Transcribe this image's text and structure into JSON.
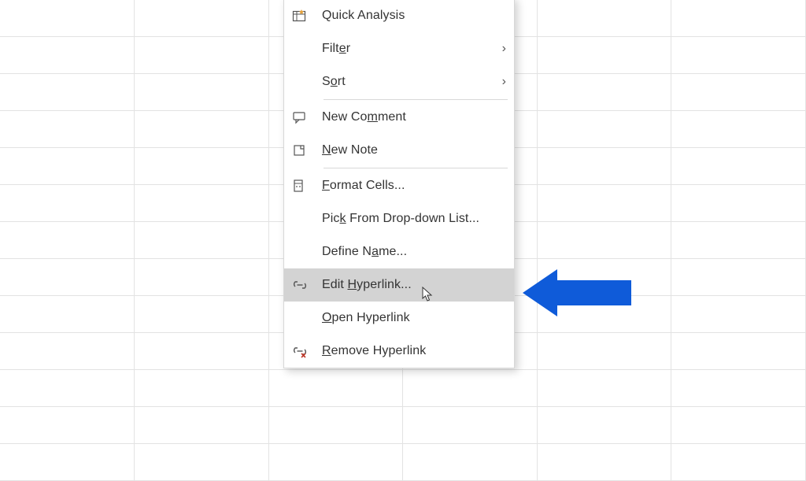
{
  "grid": {
    "rows": 12,
    "cols": 6
  },
  "menu": {
    "quick_analysis": "Quick Analysis",
    "filter": "Filter",
    "filter_pre": "Filt",
    "filter_u": "e",
    "filter_post": "r",
    "sort": "Sort",
    "sort_pre": "S",
    "sort_u": "o",
    "sort_post": "rt",
    "new_comment": "New Comment",
    "new_comment_pre": "New Co",
    "new_comment_u": "m",
    "new_comment_post": "ment",
    "new_note": "New Note",
    "new_note_pre": "",
    "new_note_u": "N",
    "new_note_post": "ew Note",
    "format_cells": "Format Cells...",
    "format_cells_pre": "",
    "format_cells_u": "F",
    "format_cells_post": "ormat Cells...",
    "pick_from_list": "Pick From Drop-down List...",
    "pick_from_list_pre": "Pic",
    "pick_from_list_u": "k",
    "pick_from_list_post": " From Drop-down List...",
    "define_name": "Define Name...",
    "define_name_pre": "Define N",
    "define_name_u": "a",
    "define_name_post": "me...",
    "edit_hyperlink": "Edit Hyperlink...",
    "edit_hyperlink_pre": "Edit ",
    "edit_hyperlink_u": "H",
    "edit_hyperlink_post": "yperlink...",
    "open_hyperlink": "Open Hyperlink",
    "open_hyperlink_pre": "",
    "open_hyperlink_u": "O",
    "open_hyperlink_post": "pen Hyperlink",
    "remove_hyperlink": "Remove Hyperlink",
    "remove_hyperlink_pre": "",
    "remove_hyperlink_u": "R",
    "remove_hyperlink_post": "emove Hyperlink",
    "chevron": "›"
  },
  "colors": {
    "arrow": "#0f5bd9",
    "highlight": "#d3d3d3"
  }
}
